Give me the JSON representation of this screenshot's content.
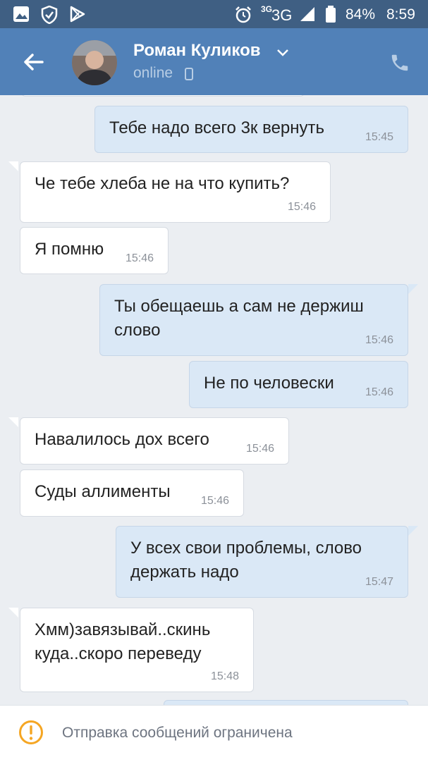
{
  "status_bar": {
    "network": "3G",
    "network_small": "3G",
    "battery": "84%",
    "time": "8:59"
  },
  "header": {
    "contact_name": "Роман Куликов",
    "contact_status": "online",
    "icons": [
      "back-arrow-icon",
      "chevron-down-icon",
      "mobile-phone-icon",
      "phone-icon"
    ]
  },
  "messages": [
    {
      "dir": "out",
      "text": "Тебе надо всего 3к вернуть",
      "time": "15:45"
    },
    {
      "dir": "in",
      "text": "Че тебе хлеба не на что купить?",
      "time": "15:46"
    },
    {
      "dir": "in",
      "text": "Я помню",
      "time": "15:46"
    },
    {
      "dir": "out",
      "text": "Ты обещаешь а сам не держиш\nслово",
      "time": "15:46"
    },
    {
      "dir": "out",
      "text": "Не по человески",
      "time": "15:46"
    },
    {
      "dir": "in",
      "text": "Навалилось дох всего",
      "time": "15:46"
    },
    {
      "dir": "in",
      "text": "Суды аллименты",
      "time": "15:46"
    },
    {
      "dir": "out",
      "text": "У всех свои проблемы, слово\nдержать надо",
      "time": "15:47"
    },
    {
      "dir": "in",
      "text": "Хмм)завязывай..скинь\nкуда..скоро переведу",
      "time": "15:48"
    }
  ],
  "bottom_bar": {
    "notice": "Отправка сообщений ограничена",
    "icon": "warning-icon"
  },
  "colors": {
    "status_bar_bg": "#3f5f83",
    "header_bg": "#5181b8",
    "chat_bg": "#ebeef2",
    "incoming_bubble": "#ffffff",
    "outgoing_bubble": "#dae8f6",
    "warning": "#f5a623"
  }
}
